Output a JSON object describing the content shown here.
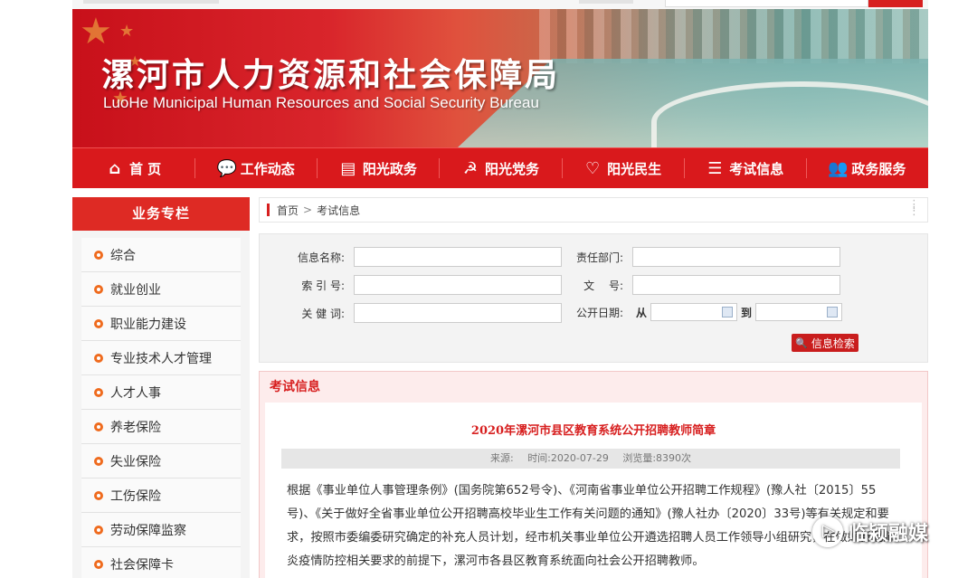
{
  "banner": {
    "title_cn": "漯河市人力资源和社会保障局",
    "title_en": "LuoHe Municipal Human Resources and Social Security Bureau"
  },
  "nav": {
    "items": [
      {
        "label": "首 页",
        "icon": "home-icon"
      },
      {
        "label": "工作动态",
        "icon": "chat-icon"
      },
      {
        "label": "阳光政务",
        "icon": "document-icon"
      },
      {
        "label": "阳光党务",
        "icon": "party-emblem-icon"
      },
      {
        "label": "阳光民生",
        "icon": "handshake-icon"
      },
      {
        "label": "考试信息",
        "icon": "list-icon"
      },
      {
        "label": "政务服务",
        "icon": "people-icon"
      }
    ]
  },
  "sidebar": {
    "title": "业务专栏",
    "items": [
      {
        "label": "综合"
      },
      {
        "label": "就业创业"
      },
      {
        "label": "职业能力建设"
      },
      {
        "label": "专业技术人才管理"
      },
      {
        "label": "人才人事"
      },
      {
        "label": "养老保险"
      },
      {
        "label": "失业保险"
      },
      {
        "label": "工伤保险"
      },
      {
        "label": "劳动保障监察"
      },
      {
        "label": "社会保障卡"
      }
    ]
  },
  "breadcrumb": {
    "home": "首页",
    "separator": ">",
    "current": "考试信息"
  },
  "filter": {
    "info_name_label": "信息名称:",
    "department_label": "责任部门:",
    "index_label": "索 引 号:",
    "doc_no_label": "文　 号:",
    "keyword_label": "关 健 词:",
    "date_label": "公开日期:",
    "from_label": "从",
    "to_label": "到",
    "search_button": "信息检索"
  },
  "content": {
    "section_title": "考试信息",
    "article_title": "2020年漯河市县区教育系统公开招聘教师简章",
    "source": "来源:",
    "time": "时间:2020-07-29",
    "views": "浏览量:8390次",
    "body": "根据《事业单位人事管理条例》(国务院第652号令)、《河南省事业单位公开招聘工作规程》(豫人社〔2015〕55号)、《关于做好全省事业单位公开招聘高校毕业生工作有关问题的通知》(豫人社办〔2020〕33号)等有关规定和要求，按照市委编委研究确定的补充人员计划，经市机关事业单位公开遴选招聘人员工作领导小组研究，在做好新冠肺炎疫情防控相关要求的前提下，漯河市各县区教育系统面向社会公开招聘教师。"
  },
  "watermark": {
    "text": "临颍融媒"
  },
  "colors": {
    "brand_red": "#d9191c",
    "title_red": "#d71f1f",
    "bullet_orange": "#ef6b1e"
  }
}
